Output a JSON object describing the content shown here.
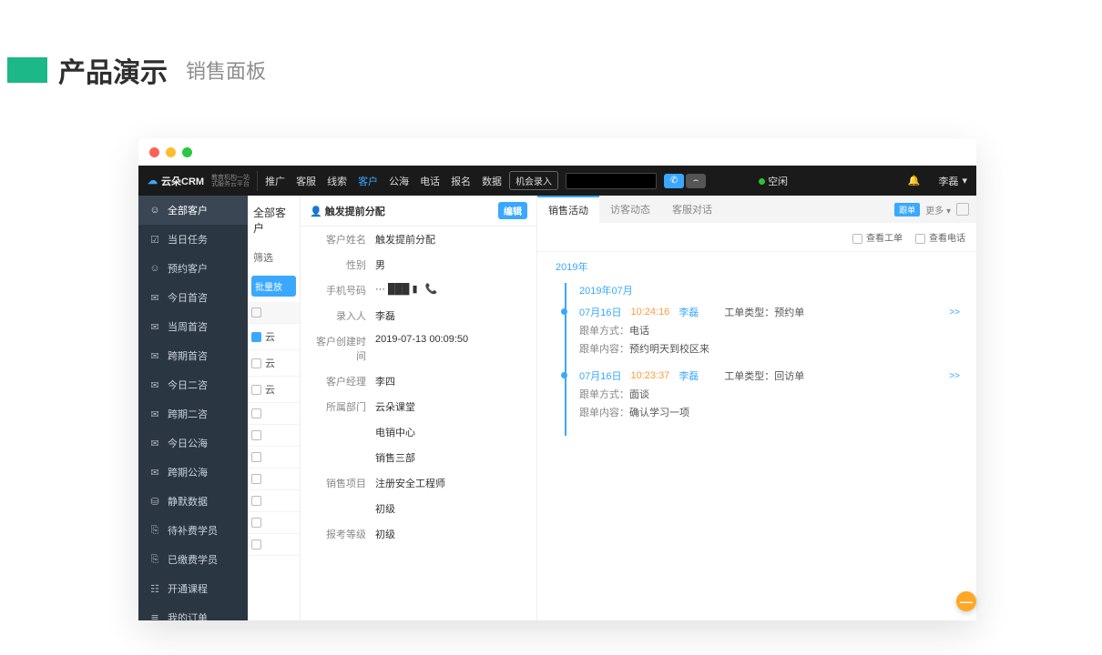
{
  "page": {
    "title_main": "产品演示",
    "title_sub": "销售面板"
  },
  "topbar": {
    "logo_main": "云朵CRM",
    "logo_sub1": "教育机构一站",
    "logo_sub2": "式服务云平台",
    "nav": [
      "推广",
      "客服",
      "线索",
      "客户",
      "公海",
      "电话",
      "报名",
      "数据"
    ],
    "nav_active_index": 3,
    "opportunity_btn": "机会录入",
    "status_label": "空闲",
    "user_name": "李磊"
  },
  "sidebar": {
    "header": "全部客户",
    "items": [
      {
        "icon": "☑",
        "label": "当日任务"
      },
      {
        "icon": "☺",
        "label": "预约客户"
      },
      {
        "icon": "✉",
        "label": "今日首咨"
      },
      {
        "icon": "✉",
        "label": "当周首咨"
      },
      {
        "icon": "✉",
        "label": "跨期首咨"
      },
      {
        "icon": "✉",
        "label": "今日二咨"
      },
      {
        "icon": "✉",
        "label": "跨期二咨"
      },
      {
        "icon": "✉",
        "label": "今日公海"
      },
      {
        "icon": "✉",
        "label": "跨期公海"
      },
      {
        "icon": "⛁",
        "label": "静默数据"
      },
      {
        "icon": "⎘",
        "label": "待补费学员"
      },
      {
        "icon": "⎘",
        "label": "已缴费学员"
      },
      {
        "icon": "☷",
        "label": "开通课程"
      },
      {
        "icon": "≣",
        "label": "我的订单"
      }
    ]
  },
  "mid": {
    "title": "全部客户",
    "filter_label": "筛选",
    "batch_btn": "批量放",
    "row_label": "云"
  },
  "detail": {
    "header_prefix": "▲",
    "header_title": "触发提前分配",
    "edit_btn": "编辑",
    "rows": [
      {
        "label": "客户姓名",
        "value": "触发提前分配"
      },
      {
        "label": "性别",
        "value": "男"
      },
      {
        "label": "手机号码",
        "value": "··· ███ ▮"
      },
      {
        "label": "录入人",
        "value": "李磊"
      },
      {
        "label": "客户创建时间",
        "value": "2019-07-13 00:09:50"
      },
      {
        "label": "客户经理",
        "value": "李四"
      },
      {
        "label": "所属部门",
        "value": "云朵课堂"
      },
      {
        "label": "",
        "value": "电销中心"
      },
      {
        "label": "",
        "value": "销售三部"
      },
      {
        "label": "销售项目",
        "value": "注册安全工程师"
      },
      {
        "label": "",
        "value": "初级"
      },
      {
        "label": "报考等级",
        "value": "初级"
      }
    ]
  },
  "timeline": {
    "tabs": [
      "销售活动",
      "访客动态",
      "客服对话"
    ],
    "active_tab": 0,
    "tool_badge": "跟单",
    "tool_more": "更多 ▾",
    "filter_ticket": "查看工单",
    "filter_call": "查看电话",
    "year": "2019年",
    "month": "2019年07月",
    "entries": [
      {
        "date": "07月16日",
        "time": "10:24:16",
        "who": "李磊",
        "type_label": "工单类型：",
        "type_value": "预约单",
        "more": ">>",
        "lines": [
          {
            "k": "跟单方式：",
            "v": "电话"
          },
          {
            "k": "跟单内容：",
            "v": "预约明天到校区来"
          }
        ]
      },
      {
        "date": "07月16日",
        "time": "10:23:37",
        "who": "李磊",
        "type_label": "工单类型：",
        "type_value": "回访单",
        "more": ">>",
        "lines": [
          {
            "k": "跟单方式：",
            "v": "面谈"
          },
          {
            "k": "跟单内容：",
            "v": "确认学习一项"
          }
        ]
      }
    ]
  },
  "bubble": "—"
}
